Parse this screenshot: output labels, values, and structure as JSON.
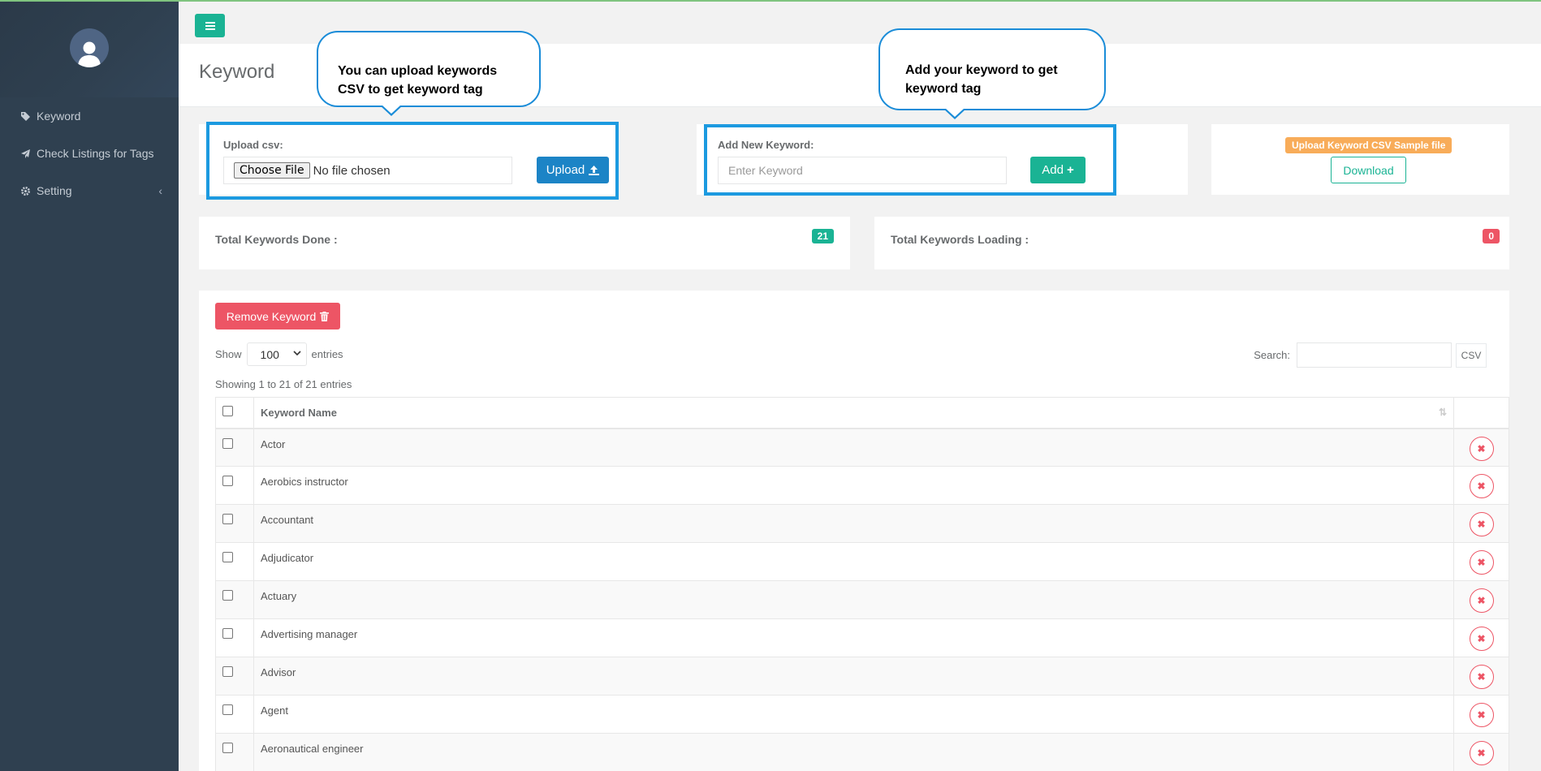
{
  "sidebar": {
    "items": [
      {
        "label": "Keyword",
        "icon": "tag-icon"
      },
      {
        "label": "Check Listings for Tags",
        "icon": "paper-plane-icon"
      },
      {
        "label": "Setting",
        "icon": "gear-icon"
      }
    ]
  },
  "header": {
    "title": "Keyword"
  },
  "callouts": {
    "upload": "You can upload keywords CSV to get keyword tag",
    "add": "Add your keyword to get keyword tag"
  },
  "upload_panel": {
    "label": "Upload csv:",
    "choose_label": "Choose File",
    "no_file": "No file chosen",
    "button": "Upload"
  },
  "add_panel": {
    "label": "Add New Keyword:",
    "placeholder": "Enter Keyword",
    "button": "Add"
  },
  "sample_panel": {
    "badge": "Upload Keyword CSV Sample file",
    "button": "Download"
  },
  "stats": {
    "done_label": "Total Keywords Done :",
    "done_count": "21",
    "loading_label": "Total Keywords Loading :",
    "loading_count": "0"
  },
  "table_panel": {
    "remove_button": "Remove Keyword",
    "show_label": "Show",
    "entries_value": "100",
    "entries_label": "entries",
    "search_label": "Search:",
    "csv_button": "CSV",
    "info": "Showing 1 to 21 of 21 entries",
    "column": "Keyword Name",
    "rows": [
      "Actor",
      "Aerobics instructor",
      "Accountant",
      "Adjudicator",
      "Actuary",
      "Advertising manager",
      "Advisor",
      "Agent",
      "Aeronautical engineer"
    ]
  },
  "colors": {
    "sidebar": "#2f4050",
    "primary": "#1ab394",
    "blue": "#1c84c6",
    "danger": "#ed5565",
    "warning": "#f8ac59",
    "highlight": "#1c9ae0"
  }
}
